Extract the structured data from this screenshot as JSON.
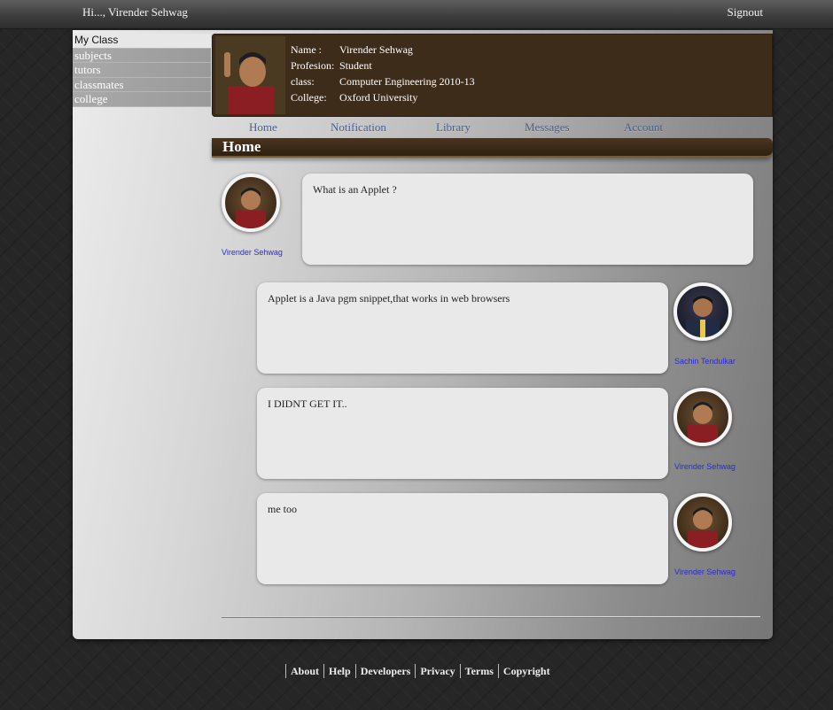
{
  "header": {
    "greeting": "Hi..., Virender Sehwag",
    "signout_label": "Signout"
  },
  "sidebar": {
    "items": [
      {
        "label": "My Class"
      },
      {
        "label": "subjects"
      },
      {
        "label": "tutors"
      },
      {
        "label": "classmates"
      },
      {
        "label": "college"
      }
    ]
  },
  "profile": {
    "name_key": "Name :",
    "name": "Virender Sehwag",
    "profession_key": "Profesion:",
    "profession": "Student",
    "class_key": "class:",
    "class": "Computer Engineering 2010-13",
    "college_key": "College:",
    "college": "Oxford University"
  },
  "nav": {
    "items": [
      {
        "label": "Home"
      },
      {
        "label": "Notification"
      },
      {
        "label": "Library"
      },
      {
        "label": "Messages"
      },
      {
        "label": "Account"
      }
    ]
  },
  "section": {
    "title": "Home"
  },
  "posts": [
    {
      "author": "Virender Sehwag",
      "text": "What is an Applet ?"
    },
    {
      "author": "Sachin Tendulkar",
      "text": "Applet is a Java pgm snippet,that works in web browsers"
    },
    {
      "author": "Virender Sehwag",
      "text": "I DIDNT GET IT.."
    },
    {
      "author": "Virender Sehwag",
      "text": "me too"
    }
  ],
  "footer": {
    "links": [
      {
        "label": "About"
      },
      {
        "label": "Help"
      },
      {
        "label": "Developers"
      },
      {
        "label": "Privacy"
      },
      {
        "label": "Terms"
      },
      {
        "label": "Copyright"
      }
    ]
  },
  "colors": {
    "accent_brown": "#3e2c1b",
    "link_blue": "#2b2bd6",
    "nav_blue": "#4a5f8a"
  }
}
